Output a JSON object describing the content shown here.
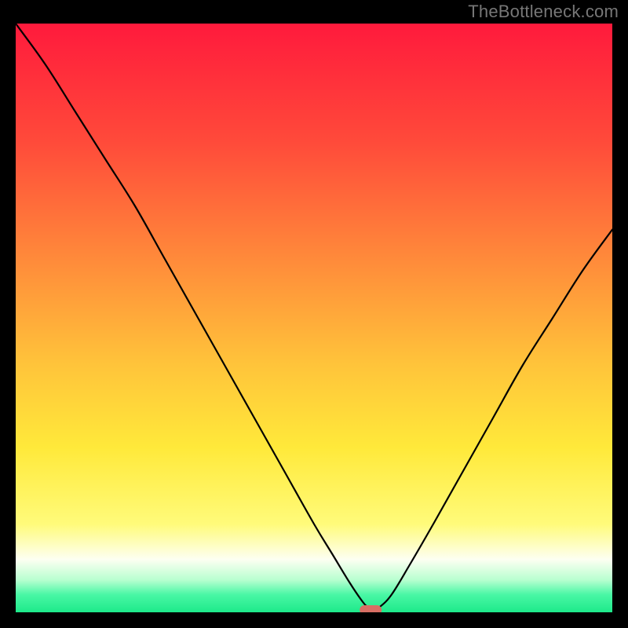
{
  "watermark": "TheBottleneck.com",
  "colors": {
    "gradient_stops": [
      {
        "offset": 0.0,
        "color": "#ff1a3c"
      },
      {
        "offset": 0.2,
        "color": "#ff4a3a"
      },
      {
        "offset": 0.4,
        "color": "#ff8a3a"
      },
      {
        "offset": 0.58,
        "color": "#ffc43a"
      },
      {
        "offset": 0.72,
        "color": "#ffe93a"
      },
      {
        "offset": 0.85,
        "color": "#fffb7a"
      },
      {
        "offset": 0.91,
        "color": "#fdfff2"
      },
      {
        "offset": 0.945,
        "color": "#b8ffd0"
      },
      {
        "offset": 0.97,
        "color": "#49f7a5"
      },
      {
        "offset": 1.0,
        "color": "#1de98a"
      }
    ],
    "curve": "#000000",
    "marker": "#d86f64",
    "frame": "#000000"
  },
  "chart_data": {
    "type": "line",
    "title": "",
    "xlabel": "",
    "ylabel": "",
    "xlim": [
      0,
      100
    ],
    "ylim": [
      0,
      100
    ],
    "legend": false,
    "grid": false,
    "series": [
      {
        "name": "bottleneck-curve",
        "x": [
          0,
          5,
          10,
          15,
          20,
          25,
          30,
          35,
          40,
          45,
          50,
          53,
          56,
          58,
          59,
          60,
          61,
          63,
          66,
          70,
          75,
          80,
          85,
          90,
          95,
          100
        ],
        "y": [
          100,
          93,
          85,
          77,
          69,
          60,
          51,
          42,
          33,
          24,
          15,
          10,
          5,
          2,
          0.9,
          0.5,
          0.9,
          3,
          8,
          15,
          24,
          33,
          42,
          50,
          58,
          65
        ]
      }
    ],
    "annotations": [
      {
        "name": "optimal-marker",
        "x": 59.5,
        "y": 0.4,
        "shape": "rounded-rect",
        "color": "#d86f64"
      }
    ]
  }
}
